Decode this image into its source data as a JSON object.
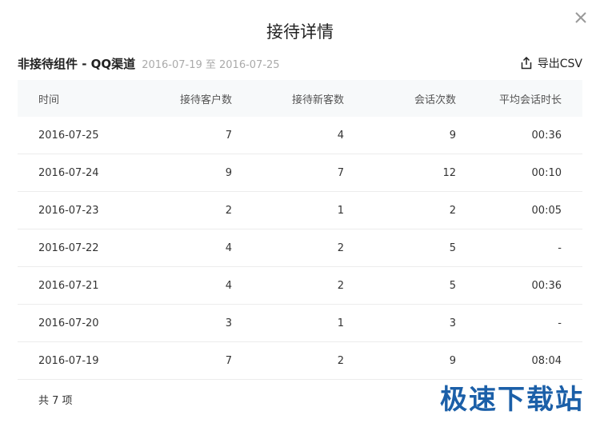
{
  "dialog": {
    "title": "接待详情",
    "close_icon": "close-icon"
  },
  "subheader": {
    "title": "非接待组件 - QQ渠道",
    "date_range": "2016-07-19 至 2016-07-25",
    "export_label": "导出CSV",
    "export_icon": "share-upload-icon"
  },
  "table": {
    "columns": [
      "时间",
      "接待客户数",
      "接待新客数",
      "会话次数",
      "平均会话时长"
    ],
    "rows": [
      [
        "2016-07-25",
        "7",
        "4",
        "9",
        "00:36"
      ],
      [
        "2016-07-24",
        "9",
        "7",
        "12",
        "00:10"
      ],
      [
        "2016-07-23",
        "2",
        "1",
        "2",
        "00:05"
      ],
      [
        "2016-07-22",
        "4",
        "2",
        "5",
        "-"
      ],
      [
        "2016-07-21",
        "4",
        "2",
        "5",
        "00:36"
      ],
      [
        "2016-07-20",
        "3",
        "1",
        "3",
        "-"
      ],
      [
        "2016-07-19",
        "7",
        "2",
        "9",
        "08:04"
      ]
    ]
  },
  "footer": {
    "total": "共 7 项"
  },
  "watermark": {
    "text": "极速下载站"
  }
}
